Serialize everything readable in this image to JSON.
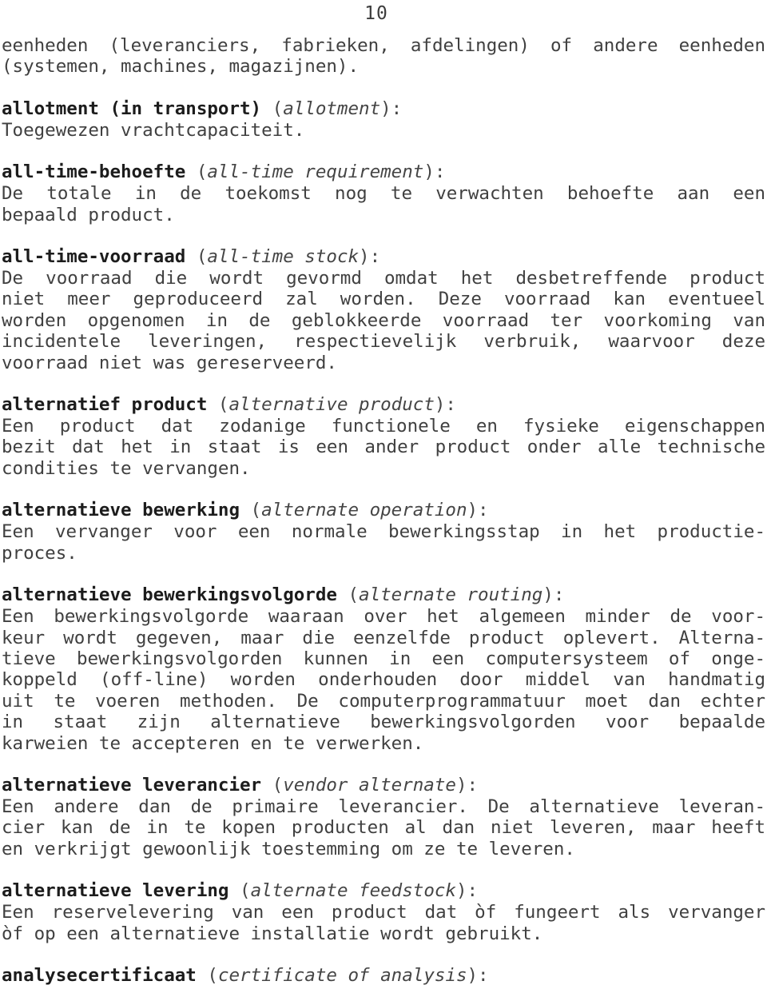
{
  "page": {
    "number": "10",
    "language": "nl",
    "document_type": "glossary"
  },
  "continued_paragraph": {
    "lines": [
      "eenheden (leveranciers, fabrieken, afdelingen) of andere eenheden",
      "(systemen, machines, magazijnen)."
    ]
  },
  "entries": [
    {
      "term": "allotment (in transport)",
      "translation": "allotment",
      "punctuation": "):",
      "open_paren": " (",
      "definition_lines": [
        "Toegewezen vrachtcapaciteit."
      ],
      "justified": [
        false
      ]
    },
    {
      "term": "all-time-behoefte",
      "translation": "all-time requirement",
      "punctuation": "):",
      "open_paren": " (",
      "definition_lines": [
        "De totale in de toekomst nog te verwachten behoefte aan een",
        "bepaald product."
      ],
      "justified": [
        true,
        false
      ]
    },
    {
      "term": "all-time-voorraad",
      "translation": "all-time stock",
      "punctuation": "):",
      "open_paren": " (",
      "definition_lines": [
        "De voorraad die wordt gevormd omdat het desbetreffende product",
        "niet meer geproduceerd zal worden. Deze voorraad kan eventueel",
        "worden opgenomen in de geblokkeerde voorraad ter voorkoming van",
        "incidentele leveringen, respectievelijk verbruik, waarvoor deze",
        "voorraad niet was gereserveerd."
      ],
      "justified": [
        true,
        true,
        true,
        true,
        false
      ]
    },
    {
      "term": "alternatief product",
      "translation": "alternative product",
      "punctuation": "):",
      "open_paren": " (",
      "definition_lines": [
        "Een product dat zodanige functionele en fysieke eigenschappen",
        "bezit dat het in staat is een ander product onder alle technische",
        "condities te vervangen."
      ],
      "justified": [
        true,
        true,
        false
      ]
    },
    {
      "term": "alternatieve bewerking",
      "translation": "alternate operation",
      "punctuation": "):",
      "open_paren": " (",
      "definition_lines": [
        "Een vervanger voor een normale bewerkingsstap in het productie-",
        "proces."
      ],
      "justified": [
        true,
        false
      ]
    },
    {
      "term": "alternatieve bewerkingsvolgorde",
      "translation": "alternate routing",
      "punctuation": "):",
      "open_paren": " (",
      "definition_lines": [
        "Een bewerkingsvolgorde waaraan over het algemeen minder de voor-",
        "keur wordt gegeven, maar die eenzelfde product oplevert. Alterna-",
        "tieve bewerkingsvolgorden kunnen in een computersysteem of onge-",
        "koppeld (off-line) worden onderhouden door middel van handmatig",
        "uit te voeren methoden. De computerprogrammatuur moet dan echter",
        "in staat zijn alternatieve bewerkingsvolgorden voor bepaalde",
        "karweien te accepteren en te verwerken."
      ],
      "justified": [
        true,
        true,
        true,
        true,
        true,
        true,
        false
      ]
    },
    {
      "term": "alternatieve leverancier",
      "translation": "vendor alternate",
      "punctuation": "):",
      "open_paren": " (",
      "definition_lines": [
        "Een andere dan de primaire leverancier. De alternatieve leveran-",
        "cier kan de in te kopen producten al dan niet leveren, maar heeft",
        "en verkrijgt gewoonlijk toestemming om ze te leveren."
      ],
      "justified": [
        true,
        true,
        false
      ]
    },
    {
      "term": "alternatieve levering",
      "translation": "alternate feedstock",
      "punctuation": "):",
      "open_paren": " (",
      "definition_lines": [
        "Een reservelevering van een product dat òf fungeert als vervanger",
        "òf op een alternatieve installatie wordt gebruikt."
      ],
      "justified": [
        true,
        false
      ]
    },
    {
      "term": "analysecertificaat",
      "translation": "certificate of analysis",
      "punctuation": "):",
      "open_paren": " (",
      "definition_lines": [],
      "justified": []
    }
  ]
}
